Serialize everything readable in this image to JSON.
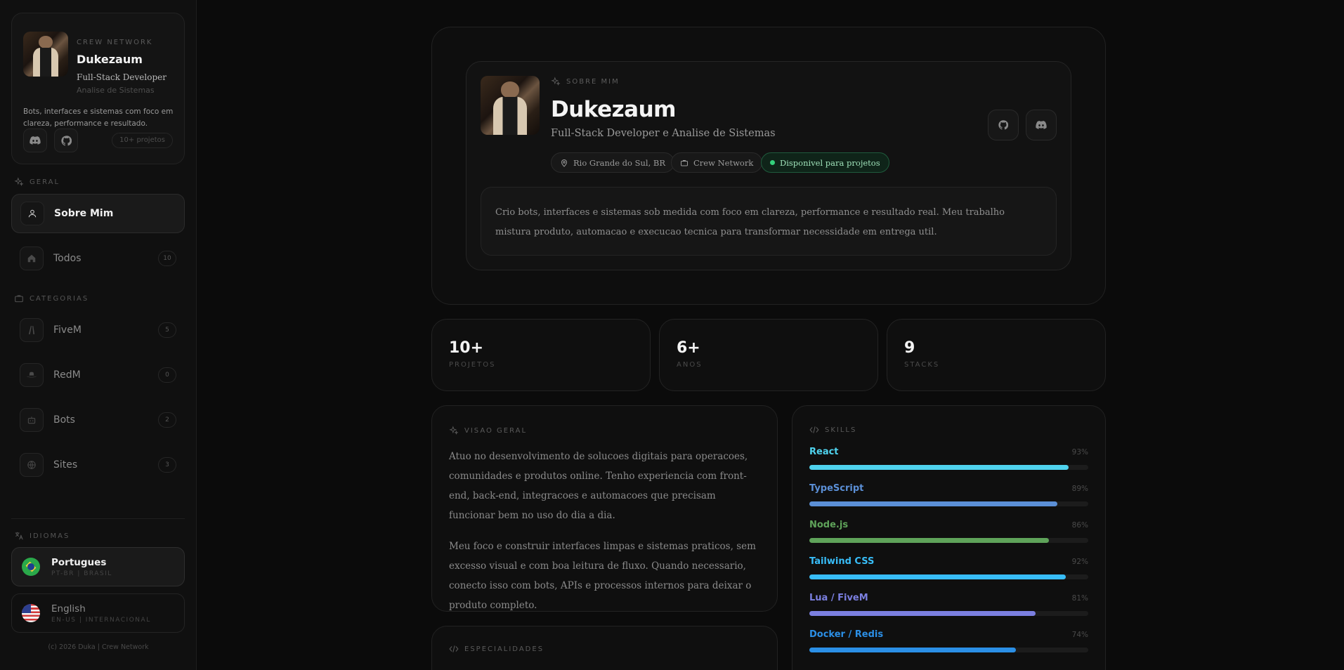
{
  "sidebar": {
    "profile": {
      "kicker": "CREW NETWORK",
      "name": "Dukezaum",
      "role": "Full-Stack Developer",
      "sub": "Analise de Sistemas",
      "description": "Bots, interfaces e sistemas com foco em clareza, performance e resultado.",
      "badge": "10+ projetos"
    },
    "general_label": "GERAL",
    "nav_general": [
      {
        "label": "Sobre Mim",
        "count": ""
      },
      {
        "label": "Todos",
        "count": "10"
      }
    ],
    "categories_label": "CATEGORIAS",
    "nav_categories": [
      {
        "label": "FiveM",
        "count": "5"
      },
      {
        "label": "RedM",
        "count": "0"
      },
      {
        "label": "Bots",
        "count": "2"
      },
      {
        "label": "Sites",
        "count": "3"
      }
    ],
    "languages_label": "IDIOMAS",
    "languages": [
      {
        "name": "Portugues",
        "code": "PT-BR | BRASIL"
      },
      {
        "name": "English",
        "code": "EN-US | INTERNACIONAL"
      }
    ],
    "footer": "(c) 2026 Duka | Crew Network"
  },
  "hero": {
    "kicker": "SOBRE MIM",
    "name": "Dukezaum",
    "role": "Full-Stack Developer e Analise de Sistemas",
    "location": "Rio Grande do Sul, BR",
    "network": "Crew Network",
    "availability": "Disponivel para projetos",
    "bio": "Crio bots, interfaces e sistemas sob medida com foco em clareza, performance e resultado real. Meu trabalho mistura produto, automacao e execucao tecnica para transformar necessidade em entrega util."
  },
  "stats": [
    {
      "value": "10+",
      "label": "PROJETOS"
    },
    {
      "value": "6+",
      "label": "ANOS"
    },
    {
      "value": "9",
      "label": "STACKS"
    }
  ],
  "overview": {
    "kicker": "VISAO GERAL",
    "paragraphs": [
      "Atuo no desenvolvimento de solucoes digitais para operacoes, comunidades e produtos online. Tenho experiencia com front-end, back-end, integracoes e automacoes que precisam funcionar bem no uso do dia a dia.",
      "Meu foco e construir interfaces limpas e sistemas praticos, sem excesso visual e com boa leitura de fluxo. Quando necessario, conecto isso com bots, APIs e processos internos para deixar o produto completo."
    ]
  },
  "specialties": {
    "kicker": "ESPECIALIDADES"
  },
  "skills": {
    "kicker": "SKILLS",
    "items": [
      {
        "name": "React",
        "pct_label": "93%",
        "level": 0.93,
        "color": "#4fd3ee"
      },
      {
        "name": "TypeScript",
        "pct_label": "89%",
        "level": 0.89,
        "color": "#5b8fd6"
      },
      {
        "name": "Node.js",
        "pct_label": "86%",
        "level": 0.86,
        "color": "#5fa35a"
      },
      {
        "name": "Tailwind CSS",
        "pct_label": "92%",
        "level": 0.92,
        "color": "#38bdf8"
      },
      {
        "name": "Lua / FiveM",
        "pct_label": "81%",
        "level": 0.81,
        "color": "#7b7fe0"
      },
      {
        "name": "Docker / Redis",
        "pct_label": "74%",
        "level": 0.74,
        "color": "#2b8fe6"
      }
    ]
  }
}
